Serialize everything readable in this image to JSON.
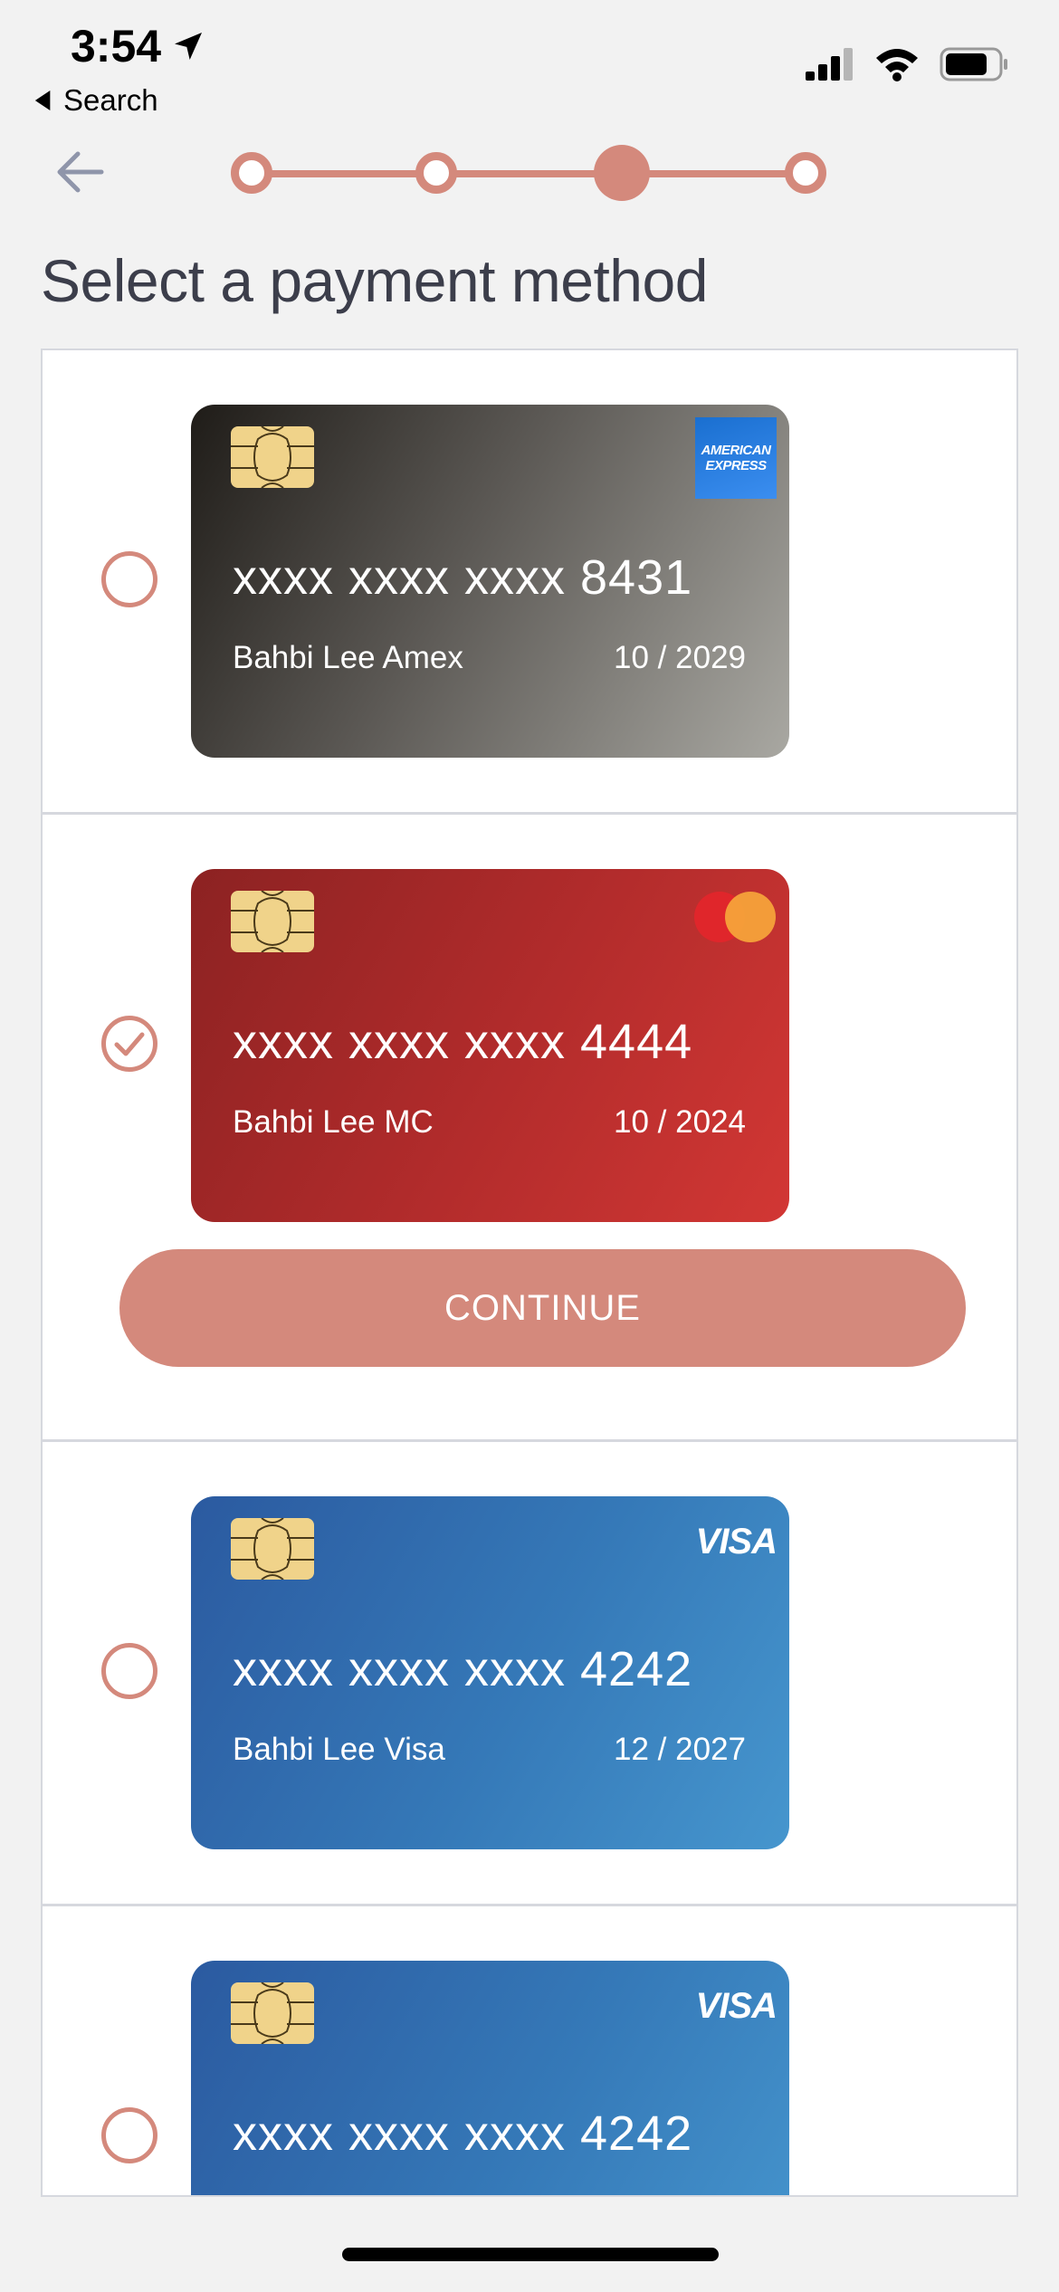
{
  "status_bar": {
    "time": "3:54",
    "back_label": "Search"
  },
  "header": {
    "title": "Select a payment method",
    "stepper": {
      "total_steps": 4,
      "current_step": 3
    }
  },
  "colors": {
    "accent": "#d4897c",
    "title": "#3c3e4b",
    "background": "#f2f2f2"
  },
  "cards": [
    {
      "brand": "amex-logo",
      "brand_text_1": "AMERICAN",
      "brand_text_2": "EXPRESS",
      "number": "xxxx xxxx xxxx 8431",
      "name": "Bahbi Lee Amex",
      "expiry": "10 / 2029",
      "selected": false
    },
    {
      "brand": "mastercard-logo",
      "number": "xxxx xxxx xxxx 4444",
      "name": "Bahbi Lee MC",
      "expiry": "10 / 2024",
      "selected": true
    },
    {
      "brand": "visa-logo",
      "brand_text": "VISA",
      "number": "xxxx xxxx xxxx 4242",
      "name": "Bahbi Lee Visa",
      "expiry": "12 / 2027",
      "selected": false
    },
    {
      "brand": "visa-logo",
      "brand_text": "VISA",
      "number": "xxxx xxxx xxxx 4242",
      "selected": false
    }
  ],
  "continue_button": {
    "label": "CONTINUE"
  }
}
